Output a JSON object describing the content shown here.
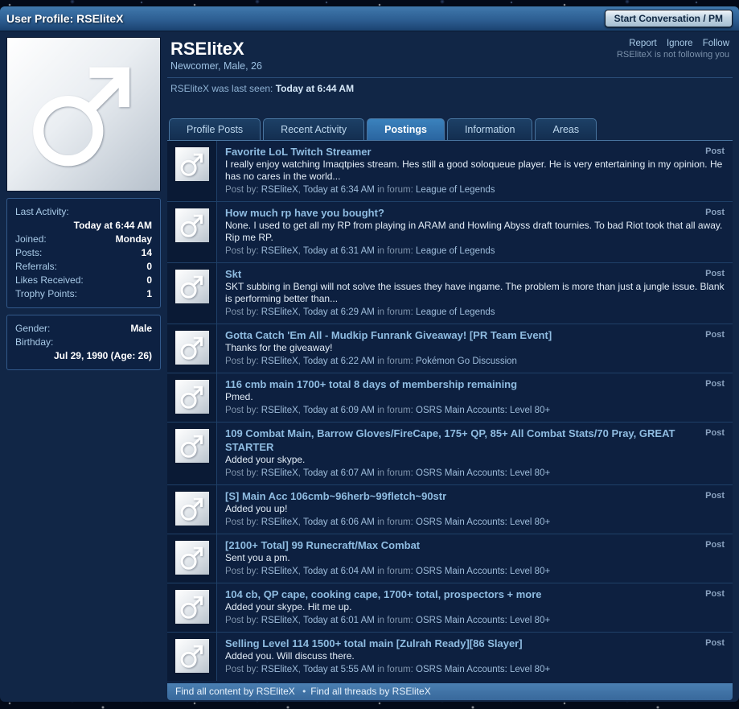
{
  "theme": {
    "accent": "#2f6da8",
    "panel_background": "#0d2040",
    "frame_background": "#112646",
    "link_color": "#9fbddb",
    "title_link_color": "#8fbce1",
    "header_gradient_top": "#4079ad"
  },
  "header": {
    "title": "User Profile: RSEliteX",
    "pm_button_label": "Start Conversation / PM"
  },
  "profile": {
    "username": "RSEliteX",
    "subtitle": "Newcomer, Male, 26",
    "actions": [
      {
        "label": "Report"
      },
      {
        "label": "Ignore"
      },
      {
        "label": "Follow"
      }
    ],
    "following_note": "RSEliteX is not following you",
    "last_seen_label": "RSEliteX was last seen:",
    "last_seen_value": "Today at 6:44 AM"
  },
  "sidebar": {
    "activity": {
      "last_activity_label": "Last Activity:",
      "last_activity_value": "Today at 6:44 AM",
      "rows": [
        {
          "label": "Joined:",
          "value": "Monday"
        },
        {
          "label": "Posts:",
          "value": "14"
        },
        {
          "label": "Referrals:",
          "value": "0"
        },
        {
          "label": "Likes Received:",
          "value": "0"
        },
        {
          "label": "Trophy Points:",
          "value": "1"
        }
      ]
    },
    "about": {
      "rows": [
        {
          "label": "Gender:",
          "value": "Male"
        }
      ],
      "birthday_label": "Birthday:",
      "birthday_value": "Jul 29, 1990 (Age: 26)"
    }
  },
  "tabs": [
    {
      "label": "Profile Posts",
      "active": false
    },
    {
      "label": "Recent Activity",
      "active": false
    },
    {
      "label": "Postings",
      "active": true
    },
    {
      "label": "Information",
      "active": false
    },
    {
      "label": "Areas",
      "active": false
    }
  ],
  "posts_meta": {
    "prefix": "Post by:",
    "comma": ",",
    "forum_label": "in forum:",
    "type_label": "Post"
  },
  "posts": [
    {
      "title": "Favorite LoL Twitch Streamer",
      "body": "I really enjoy watching Imaqtpies stream. Hes still a good soloqueue player. He is very entertaining in my opinion. He has no cares in the world...",
      "author": "RSEliteX",
      "time": "Today at 6:34 AM",
      "forum": "League of Legends"
    },
    {
      "title": "How much rp have you bought?",
      "body": "None. I used to get all my RP from playing in ARAM and Howling Abyss draft tournies. To bad Riot took that all away. Rip me RP.",
      "author": "RSEliteX",
      "time": "Today at 6:31 AM",
      "forum": "League of Legends"
    },
    {
      "title": "Skt",
      "body": "SKT subbing in Bengi will not solve the issues they have ingame. The problem is more than just a jungle issue. Blank is performing better than...",
      "author": "RSEliteX",
      "time": "Today at 6:29 AM",
      "forum": "League of Legends"
    },
    {
      "title": "Gotta Catch 'Em All - Mudkip Funrank Giveaway! [PR Team Event]",
      "body": "Thanks for the giveaway!",
      "author": "RSEliteX",
      "time": "Today at 6:22 AM",
      "forum": "Pokémon Go Discussion"
    },
    {
      "title": "116 cmb main 1700+ total 8 days of membership remaining",
      "body": "Pmed.",
      "author": "RSEliteX",
      "time": "Today at 6:09 AM",
      "forum": "OSRS Main Accounts: Level 80+"
    },
    {
      "title": "109 Combat Main, Barrow Gloves/FireCape, 175+ QP, 85+ All Combat Stats/70 Pray, GREAT STARTER",
      "body": "Added your skype.",
      "author": "RSEliteX",
      "time": "Today at 6:07 AM",
      "forum": "OSRS Main Accounts: Level 80+"
    },
    {
      "title": "[S] Main Acc 106cmb~96herb~99fletch~90str",
      "body": "Added you up!",
      "author": "RSEliteX",
      "time": "Today at 6:06 AM",
      "forum": "OSRS Main Accounts: Level 80+"
    },
    {
      "title": "[2100+ Total] 99 Runecraft/Max Combat",
      "body": "Sent you a pm.",
      "author": "RSEliteX",
      "time": "Today at 6:04 AM",
      "forum": "OSRS Main Accounts: Level 80+"
    },
    {
      "title": "104 cb, QP cape, cooking cape, 1700+ total, prospectors + more",
      "body": "Added your skype. Hit me up.",
      "author": "RSEliteX",
      "time": "Today at 6:01 AM",
      "forum": "OSRS Main Accounts: Level 80+"
    },
    {
      "title": "Selling Level 114 1500+ total main [Zulrah Ready][86 Slayer]",
      "body": "Added you. Will discuss there.",
      "author": "RSEliteX",
      "time": "Today at 5:55 AM",
      "forum": "OSRS Main Accounts: Level 80+"
    }
  ],
  "footer": {
    "separator": "•",
    "links": [
      {
        "label": "Find all content by RSEliteX"
      },
      {
        "label": "Find all threads by RSEliteX"
      }
    ]
  }
}
